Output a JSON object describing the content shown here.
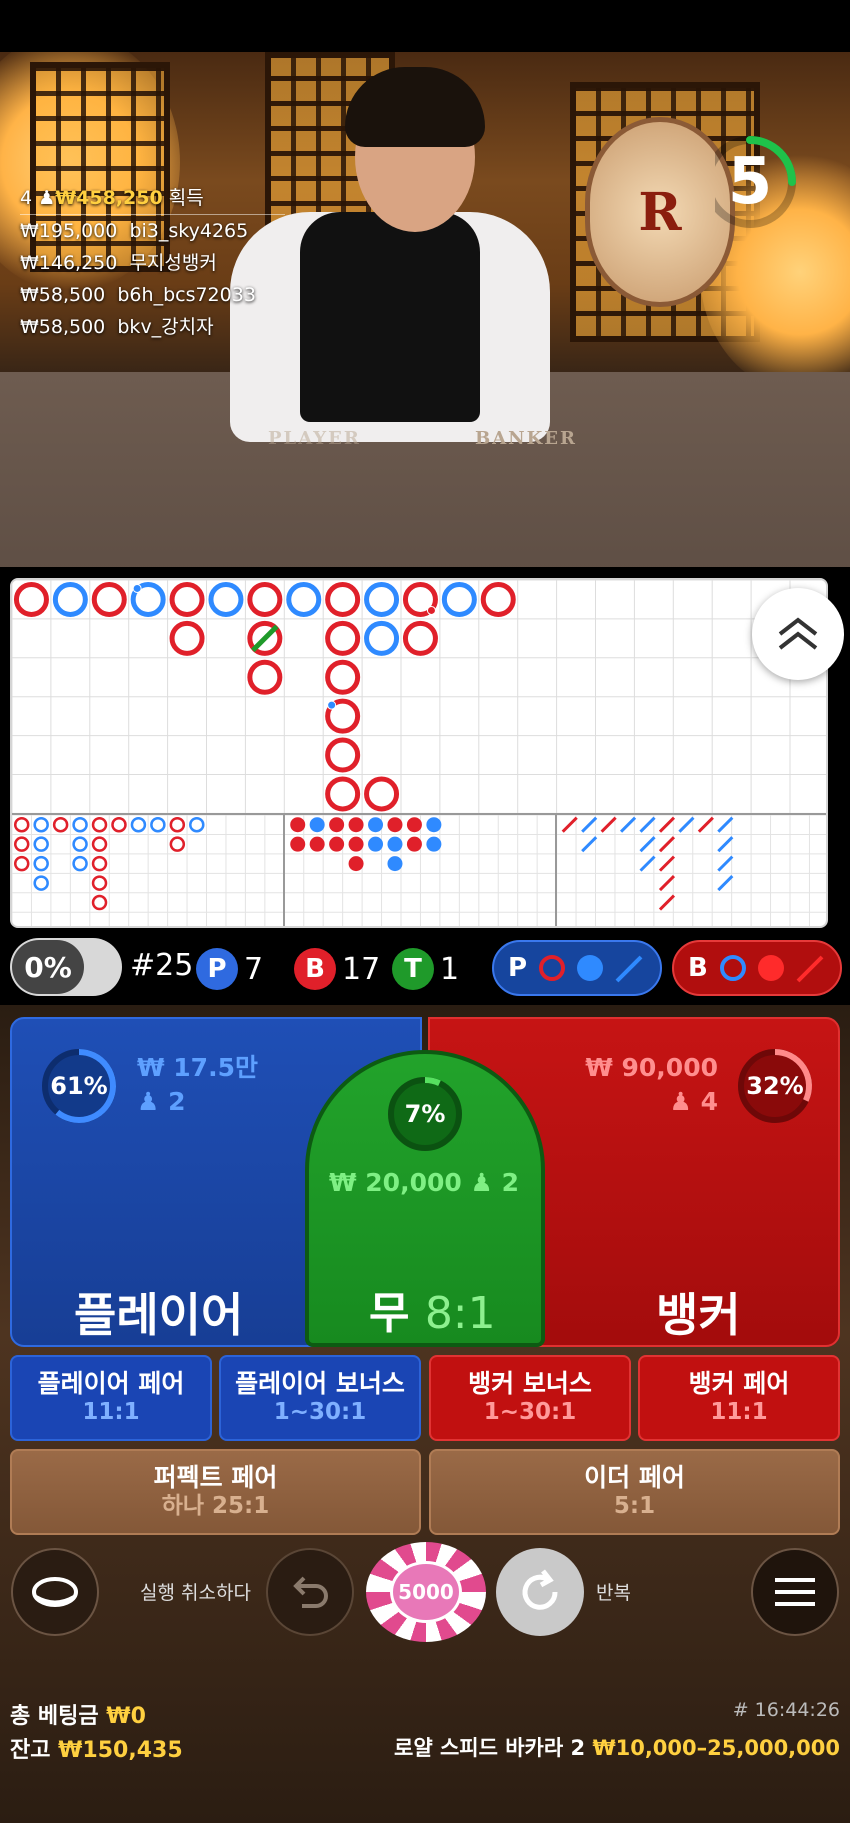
{
  "video": {
    "timer": "5",
    "timer_fraction": 0.25,
    "table_words": [
      "PLAYER",
      "BANKER"
    ],
    "logo_letter": "R",
    "winners_head": {
      "count": "4",
      "amount": "₩458,250",
      "suffix": "획득"
    },
    "winners": [
      {
        "amount": "₩195,000",
        "name": "bi3_sky4265"
      },
      {
        "amount": "₩146,250",
        "name": "무지성뱅커"
      },
      {
        "amount": "₩58,500",
        "name": "b6h_bcs72033"
      },
      {
        "amount": "₩58,500",
        "name": "bkv_강치자"
      }
    ]
  },
  "roadmap": {
    "big_road": [
      {
        "col": 0,
        "row": 0,
        "side": "B"
      },
      {
        "col": 1,
        "row": 0,
        "side": "P"
      },
      {
        "col": 2,
        "row": 0,
        "side": "B"
      },
      {
        "col": 3,
        "row": 0,
        "side": "P",
        "pair": "player"
      },
      {
        "col": 4,
        "row": 0,
        "side": "B"
      },
      {
        "col": 4,
        "row": 1,
        "side": "B"
      },
      {
        "col": 5,
        "row": 0,
        "side": "P"
      },
      {
        "col": 6,
        "row": 0,
        "side": "B"
      },
      {
        "col": 6,
        "row": 1,
        "side": "B",
        "tie": true
      },
      {
        "col": 6,
        "row": 2,
        "side": "B"
      },
      {
        "col": 7,
        "row": 0,
        "side": "P"
      },
      {
        "col": 8,
        "row": 0,
        "side": "B"
      },
      {
        "col": 8,
        "row": 1,
        "side": "B"
      },
      {
        "col": 8,
        "row": 2,
        "side": "B"
      },
      {
        "col": 8,
        "row": 3,
        "side": "B",
        "pair": "player"
      },
      {
        "col": 8,
        "row": 4,
        "side": "B"
      },
      {
        "col": 8,
        "row": 5,
        "side": "B"
      },
      {
        "col": 9,
        "row": 0,
        "side": "P"
      },
      {
        "col": 9,
        "row": 1,
        "side": "P"
      },
      {
        "col": 9,
        "row": 5,
        "side": "B"
      },
      {
        "col": 10,
        "row": 0,
        "side": "B",
        "pair": "banker"
      },
      {
        "col": 10,
        "row": 1,
        "side": "B"
      },
      {
        "col": 11,
        "row": 0,
        "side": "P"
      },
      {
        "col": 12,
        "row": 0,
        "side": "B"
      }
    ],
    "big_eye": [
      {
        "col": 0,
        "row": 0,
        "c": "R"
      },
      {
        "col": 0,
        "row": 1,
        "c": "R"
      },
      {
        "col": 0,
        "row": 2,
        "c": "R"
      },
      {
        "col": 1,
        "row": 0,
        "c": "P"
      },
      {
        "col": 1,
        "row": 1,
        "c": "P"
      },
      {
        "col": 1,
        "row": 2,
        "c": "P"
      },
      {
        "col": 1,
        "row": 3,
        "c": "P"
      },
      {
        "col": 2,
        "row": 0,
        "c": "R"
      },
      {
        "col": 3,
        "row": 0,
        "c": "P"
      },
      {
        "col": 3,
        "row": 1,
        "c": "P"
      },
      {
        "col": 3,
        "row": 2,
        "c": "P"
      },
      {
        "col": 4,
        "row": 0,
        "c": "R"
      },
      {
        "col": 4,
        "row": 1,
        "c": "R"
      },
      {
        "col": 4,
        "row": 2,
        "c": "R"
      },
      {
        "col": 4,
        "row": 3,
        "c": "R"
      },
      {
        "col": 4,
        "row": 4,
        "c": "R"
      },
      {
        "col": 5,
        "row": 0,
        "c": "R"
      },
      {
        "col": 6,
        "row": 0,
        "c": "P"
      },
      {
        "col": 7,
        "row": 0,
        "c": "P"
      },
      {
        "col": 8,
        "row": 0,
        "c": "R"
      },
      {
        "col": 8,
        "row": 1,
        "c": "R"
      },
      {
        "col": 9,
        "row": 0,
        "c": "P"
      }
    ],
    "small_road": [
      {
        "col": 0,
        "row": 0,
        "c": "R"
      },
      {
        "col": 0,
        "row": 1,
        "c": "R"
      },
      {
        "col": 1,
        "row": 0,
        "c": "P"
      },
      {
        "col": 1,
        "row": 1,
        "c": "R"
      },
      {
        "col": 2,
        "row": 0,
        "c": "R"
      },
      {
        "col": 2,
        "row": 1,
        "c": "R"
      },
      {
        "col": 3,
        "row": 0,
        "c": "R"
      },
      {
        "col": 3,
        "row": 1,
        "c": "R"
      },
      {
        "col": 3,
        "row": 2,
        "c": "R"
      },
      {
        "col": 4,
        "row": 0,
        "c": "P"
      },
      {
        "col": 4,
        "row": 1,
        "c": "P"
      },
      {
        "col": 5,
        "row": 0,
        "c": "R"
      },
      {
        "col": 5,
        "row": 1,
        "c": "P"
      },
      {
        "col": 5,
        "row": 2,
        "c": "P"
      },
      {
        "col": 6,
        "row": 0,
        "c": "R"
      },
      {
        "col": 6,
        "row": 1,
        "c": "R"
      },
      {
        "col": 7,
        "row": 0,
        "c": "P"
      },
      {
        "col": 7,
        "row": 1,
        "c": "P"
      }
    ],
    "cockroach": [
      {
        "col": 0,
        "row": 0,
        "c": "R"
      },
      {
        "col": 1,
        "row": 0,
        "c": "P"
      },
      {
        "col": 1,
        "row": 1,
        "c": "P"
      },
      {
        "col": 2,
        "row": 0,
        "c": "R"
      },
      {
        "col": 3,
        "row": 0,
        "c": "P"
      },
      {
        "col": 4,
        "row": 0,
        "c": "P"
      },
      {
        "col": 4,
        "row": 1,
        "c": "P"
      },
      {
        "col": 4,
        "row": 2,
        "c": "P"
      },
      {
        "col": 5,
        "row": 0,
        "c": "R"
      },
      {
        "col": 5,
        "row": 1,
        "c": "R"
      },
      {
        "col": 5,
        "row": 2,
        "c": "R"
      },
      {
        "col": 5,
        "row": 3,
        "c": "R"
      },
      {
        "col": 5,
        "row": 4,
        "c": "R"
      },
      {
        "col": 6,
        "row": 0,
        "c": "P"
      },
      {
        "col": 7,
        "row": 0,
        "c": "R"
      },
      {
        "col": 8,
        "row": 0,
        "c": "P"
      },
      {
        "col": 8,
        "row": 1,
        "c": "P"
      },
      {
        "col": 8,
        "row": 2,
        "c": "P"
      },
      {
        "col": 8,
        "row": 3,
        "c": "P"
      }
    ]
  },
  "stats": {
    "percent": "0%",
    "round": "#25",
    "player_letter": "P",
    "player_count": "7",
    "banker_letter": "B",
    "banker_count": "17",
    "tie_letter": "T",
    "tie_count": "1",
    "predict_player": "P",
    "predict_banker": "B"
  },
  "bets": {
    "player": {
      "percent": "61%",
      "percent_value": 61,
      "amount": "₩ 17.5만",
      "players": "2",
      "label": "플레이어"
    },
    "tie": {
      "percent": "7%",
      "percent_value": 7,
      "amount": "₩ 20,000",
      "players": "2",
      "label": "무",
      "odds": "8:1"
    },
    "banker": {
      "percent": "32%",
      "percent_value": 32,
      "amount": "₩ 90,000",
      "players": "4",
      "label": "뱅커"
    },
    "side": [
      {
        "label": "플레이어 페어",
        "odds": "11:1"
      },
      {
        "label": "플레이어 보너스",
        "odds": "1~30:1"
      },
      {
        "label": "뱅커 보너스",
        "odds": "1~30:1"
      },
      {
        "label": "뱅커 페어",
        "odds": "11:1"
      }
    ],
    "perfect_pair": {
      "label": "퍼펙트 페어",
      "odds": "하나 25:1"
    },
    "either_pair": {
      "label": "이더 페어",
      "odds": "5:1"
    }
  },
  "controls": {
    "undo_label": "실행 취소하다",
    "chip_value": "5000",
    "repeat_label": "반복"
  },
  "footer": {
    "total_bet_label": "총 베팅금",
    "total_bet": "₩0",
    "balance_label": "잔고",
    "balance": "₩150,435",
    "game_id": "# 16:44:26",
    "table_name": "로얄 스피드 바카라 2",
    "limits": "₩10,000–25,000,000"
  },
  "colors": {
    "player": "#2f6ae0",
    "banker": "#e0202a",
    "tie": "#1f9a2a",
    "gold": "#ffd040"
  }
}
